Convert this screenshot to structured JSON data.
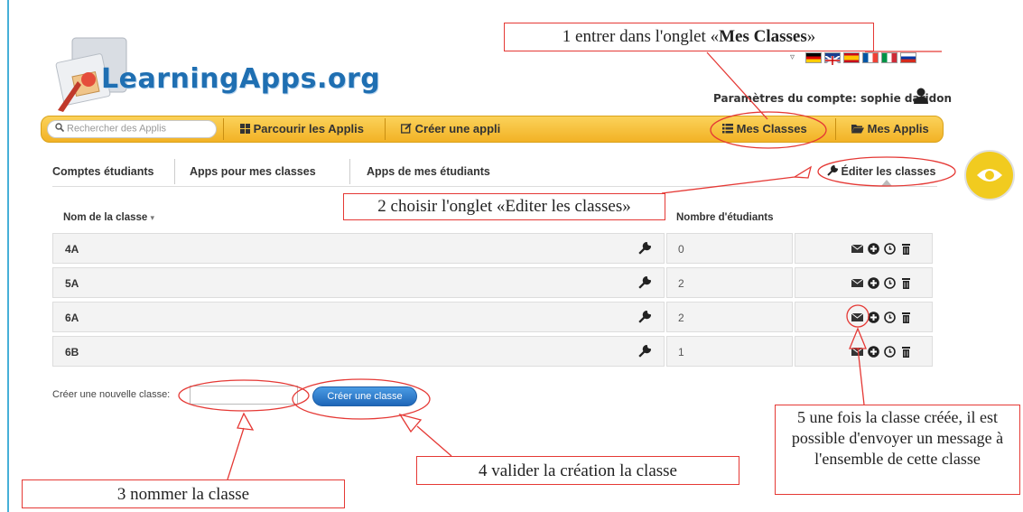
{
  "brand": {
    "name": "LearningApps.org"
  },
  "language": {
    "dropdown_icon": "caret-down-icon",
    "flags": [
      "de",
      "gb",
      "es",
      "fr",
      "it",
      "ru"
    ]
  },
  "account": {
    "label": "Paramètres du compte: sophie daridon",
    "icon": "user-icon"
  },
  "navbar": {
    "search_placeholder": "Rechercher des Applis",
    "browse": "Parcourir les Applis",
    "create": "Créer une appli",
    "classes": "Mes Classes",
    "apps": "Mes Applis"
  },
  "subtabs": {
    "students": "Comptes étudiants",
    "apps_for_classes": "Apps pour mes classes",
    "apps_of_students": "Apps de mes étudiants",
    "edit_classes": "Éditer les classes"
  },
  "table": {
    "col_name": "Nom de la classe",
    "col_count": "Nombre d'étudiants",
    "rows": [
      {
        "name": "4A",
        "count": "0"
      },
      {
        "name": "5A",
        "count": "2"
      },
      {
        "name": "6A",
        "count": "2"
      },
      {
        "name": "6B",
        "count": "1"
      }
    ]
  },
  "create_class": {
    "label": "Créer une nouvelle classe:",
    "input_value": "",
    "button": "Créer une classe"
  },
  "annotations": {
    "a1_pre": "1 entrer dans l'onglet «",
    "a1_bold": "Mes Classes",
    "a1_post": "»",
    "a2": "2 choisir l'onglet «Editer les classes»",
    "a3": "3  nommer la classe",
    "a4": "4 valider la création la classe",
    "a5": "5 une fois la classe créée, il est possible d'envoyer un message à l'ensemble de cette classe"
  },
  "colors": {
    "navbar": "#f2b225",
    "accent_blue": "#1f6fb2",
    "annotation_red": "#e53935",
    "eye_badge": "#f1cb1f"
  }
}
